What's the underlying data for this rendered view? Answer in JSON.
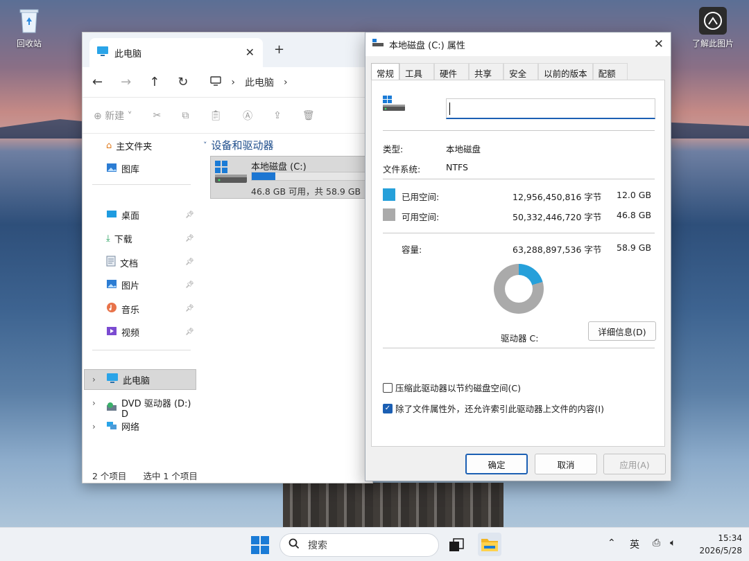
{
  "desktop": {
    "recycle_bin_label": "回收站",
    "learn_picture_label": "了解此图片"
  },
  "explorer": {
    "tab_title": "此电脑",
    "tab_close": "✕",
    "new_tab": "+",
    "address_crumb": "此电脑",
    "toolbar_new": "新建",
    "nav_items": {
      "home": "主文件夹",
      "gallery": "图库",
      "desktop": "桌面",
      "downloads": "下载",
      "documents": "文档",
      "pictures": "图片",
      "music": "音乐",
      "videos": "视频",
      "this_pc": "此电脑",
      "dvd": "DVD 驱动器 (D:) D",
      "network": "网络"
    },
    "section_title": "设备和驱动器",
    "drive": {
      "name": "本地磁盘 (C:)",
      "free_text": "46.8 GB 可用，共 58.9 GB",
      "used_fraction": 0.205
    },
    "status_items": "2 个项目",
    "status_selected": "选中 1 个项目"
  },
  "dialog": {
    "title": "本地磁盘 (C:) 属性",
    "close": "✕",
    "tabs": [
      "常规",
      "工具",
      "硬件",
      "共享",
      "安全",
      "以前的版本",
      "配额"
    ],
    "label_value": "",
    "type_label": "类型:",
    "type_value": "本地磁盘",
    "fs_label": "文件系统:",
    "fs_value": "NTFS",
    "used_label": "已用空间:",
    "used_bytes": "12,956,450,816 字节",
    "used_gb": "12.0 GB",
    "free_label": "可用空间:",
    "free_bytes": "50,332,446,720 字节",
    "free_gb": "46.8 GB",
    "capacity_label": "容量:",
    "capacity_bytes": "63,288,897,536 字节",
    "capacity_gb": "58.9 GB",
    "drive_caption": "驱动器 C:",
    "details_button": "详细信息(D)",
    "compress_label": "压缩此驱动器以节约磁盘空间(C)",
    "compress_checked": false,
    "index_label": "除了文件属性外，还允许索引此驱动器上文件的内容(I)",
    "index_checked": true,
    "ok_button": "确定",
    "cancel_button": "取消",
    "apply_button": "应用(A)",
    "used_color": "#26a0da",
    "free_color": "#aaaaaa"
  },
  "taskbar": {
    "search_placeholder": "搜索",
    "ime": "英",
    "time": "15:34",
    "date": "2026/5/28"
  }
}
